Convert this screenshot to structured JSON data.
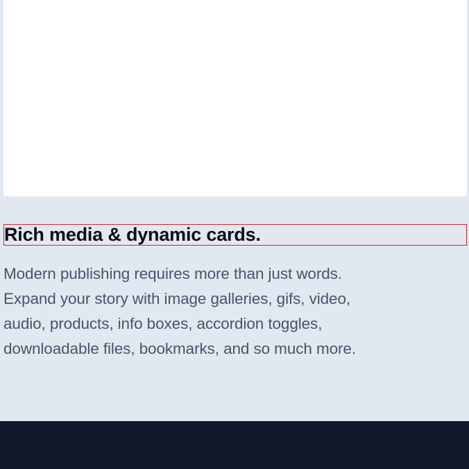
{
  "feature": {
    "heading": "Rich media & dynamic cards.",
    "body_lines": [
      "Modern publishing requires more than just words.",
      "Expand your story with image galleries, gifs, video,",
      "audio, products, info boxes, accordion toggles,",
      "downloadable files, bookmarks, and so much more."
    ]
  },
  "colors": {
    "page_background": "#e2e8f0",
    "media_placeholder": "#ffffff",
    "heading_text": "#0b0f19",
    "body_text": "#475569",
    "focus_outline": "#e0202a",
    "footer_background": "#0f172a"
  }
}
